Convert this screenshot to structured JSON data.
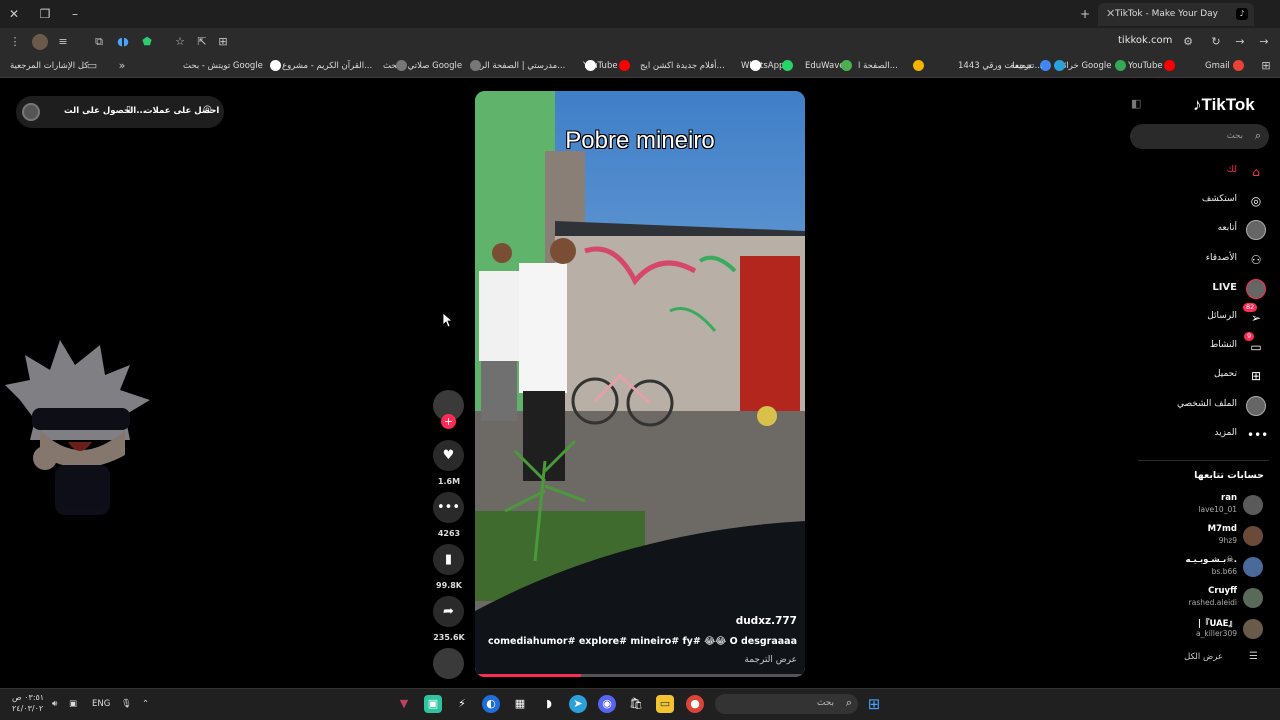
{
  "browser": {
    "tab_title": "TikTok - Make Your Day",
    "url": "tikkok.com",
    "bookmarks": [
      {
        "label": "Gmail",
        "color": "#ea4335"
      },
      {
        "label": "YouTube",
        "color": "#ff0000"
      },
      {
        "label": "خرائط Google",
        "color": "#34a853"
      },
      {
        "label": "ترجمة",
        "color": "#4285f4"
      },
      {
        "label": "تجميعات ورقي 1443...",
        "color": "#2aa1da"
      },
      {
        "label": "الصفحة ا...",
        "color": "#f4b400"
      },
      {
        "label": "EduWave",
        "color": "#4caf50"
      },
      {
        "label": "WhatsApp",
        "color": "#25d366"
      },
      {
        "label": "أفلام جديدة اكشن ايج...",
        "color": "#ffffff"
      },
      {
        "label": "YouTube",
        "color": "#ff0000"
      },
      {
        "label": "مدرستي | الصفحة الر...",
        "color": "#ffffff"
      },
      {
        "label": "صلاتي - بحث Google",
        "color": "#777777"
      },
      {
        "label": "القرآن الكريم - مشروع...",
        "color": "#777777"
      },
      {
        "label": "تويتش - بحث Google",
        "color": "#ffffff"
      }
    ],
    "all_bookmarks": "كل الإشارات المرجعية"
  },
  "left_widget": {
    "get_coins": "احصل على عملات",
    "get_app": "الحصول على الت..."
  },
  "video": {
    "title": "Pobre mineiro",
    "username": "dudxz.777",
    "caption": "comediahumor# explore# mineiro# fy# 😂😂 O desgraaaa",
    "translate": "عرض الترجمة",
    "progress": 0.32
  },
  "actions": {
    "likes": "1.6M",
    "comments": "4263",
    "saves": "99.8K",
    "shares": "235.6K"
  },
  "sidebar": {
    "logo": "TikTok",
    "search_placeholder": "بحث",
    "nav": [
      {
        "label": "لك",
        "icon": "home-icon"
      },
      {
        "label": "استكشف",
        "icon": "compass-icon"
      },
      {
        "label": "أتابعه",
        "icon": "avatar"
      },
      {
        "label": "الأصدقاء",
        "icon": "friends-icon"
      },
      {
        "label": "LIVE",
        "icon": "live-icon"
      },
      {
        "label": "الرسائل",
        "icon": "send-icon",
        "badge": "82"
      },
      {
        "label": "النشاط",
        "icon": "chat-icon",
        "badge": "9"
      },
      {
        "label": "تحميل",
        "icon": "upload-icon"
      },
      {
        "label": "الملف الشخصي",
        "icon": "profile-icon"
      },
      {
        "label": "المزيد",
        "icon": "more-icon"
      }
    ],
    "following_title": "حسابات تتابعها",
    "accounts": [
      {
        "name": "ran",
        "handle": "lave10_01"
      },
      {
        "name": "M7md",
        "handle": "9hz9"
      },
      {
        "name": "بـشـوبـيـه☠.",
        "handle": "bs.b66"
      },
      {
        "name": "Cruyff",
        "handle": "rashed.aleidi"
      },
      {
        "name": "|『UAE』",
        "handle": "a_killer309"
      }
    ],
    "see_all": "عرض الكل"
  },
  "taskbar": {
    "search_placeholder": "بحث",
    "lang": "ENG",
    "time": "٠٣:٥١ ص",
    "date": "٢٤/٠٣/٠٢"
  },
  "colors": {
    "accent": "#fe2c55"
  }
}
